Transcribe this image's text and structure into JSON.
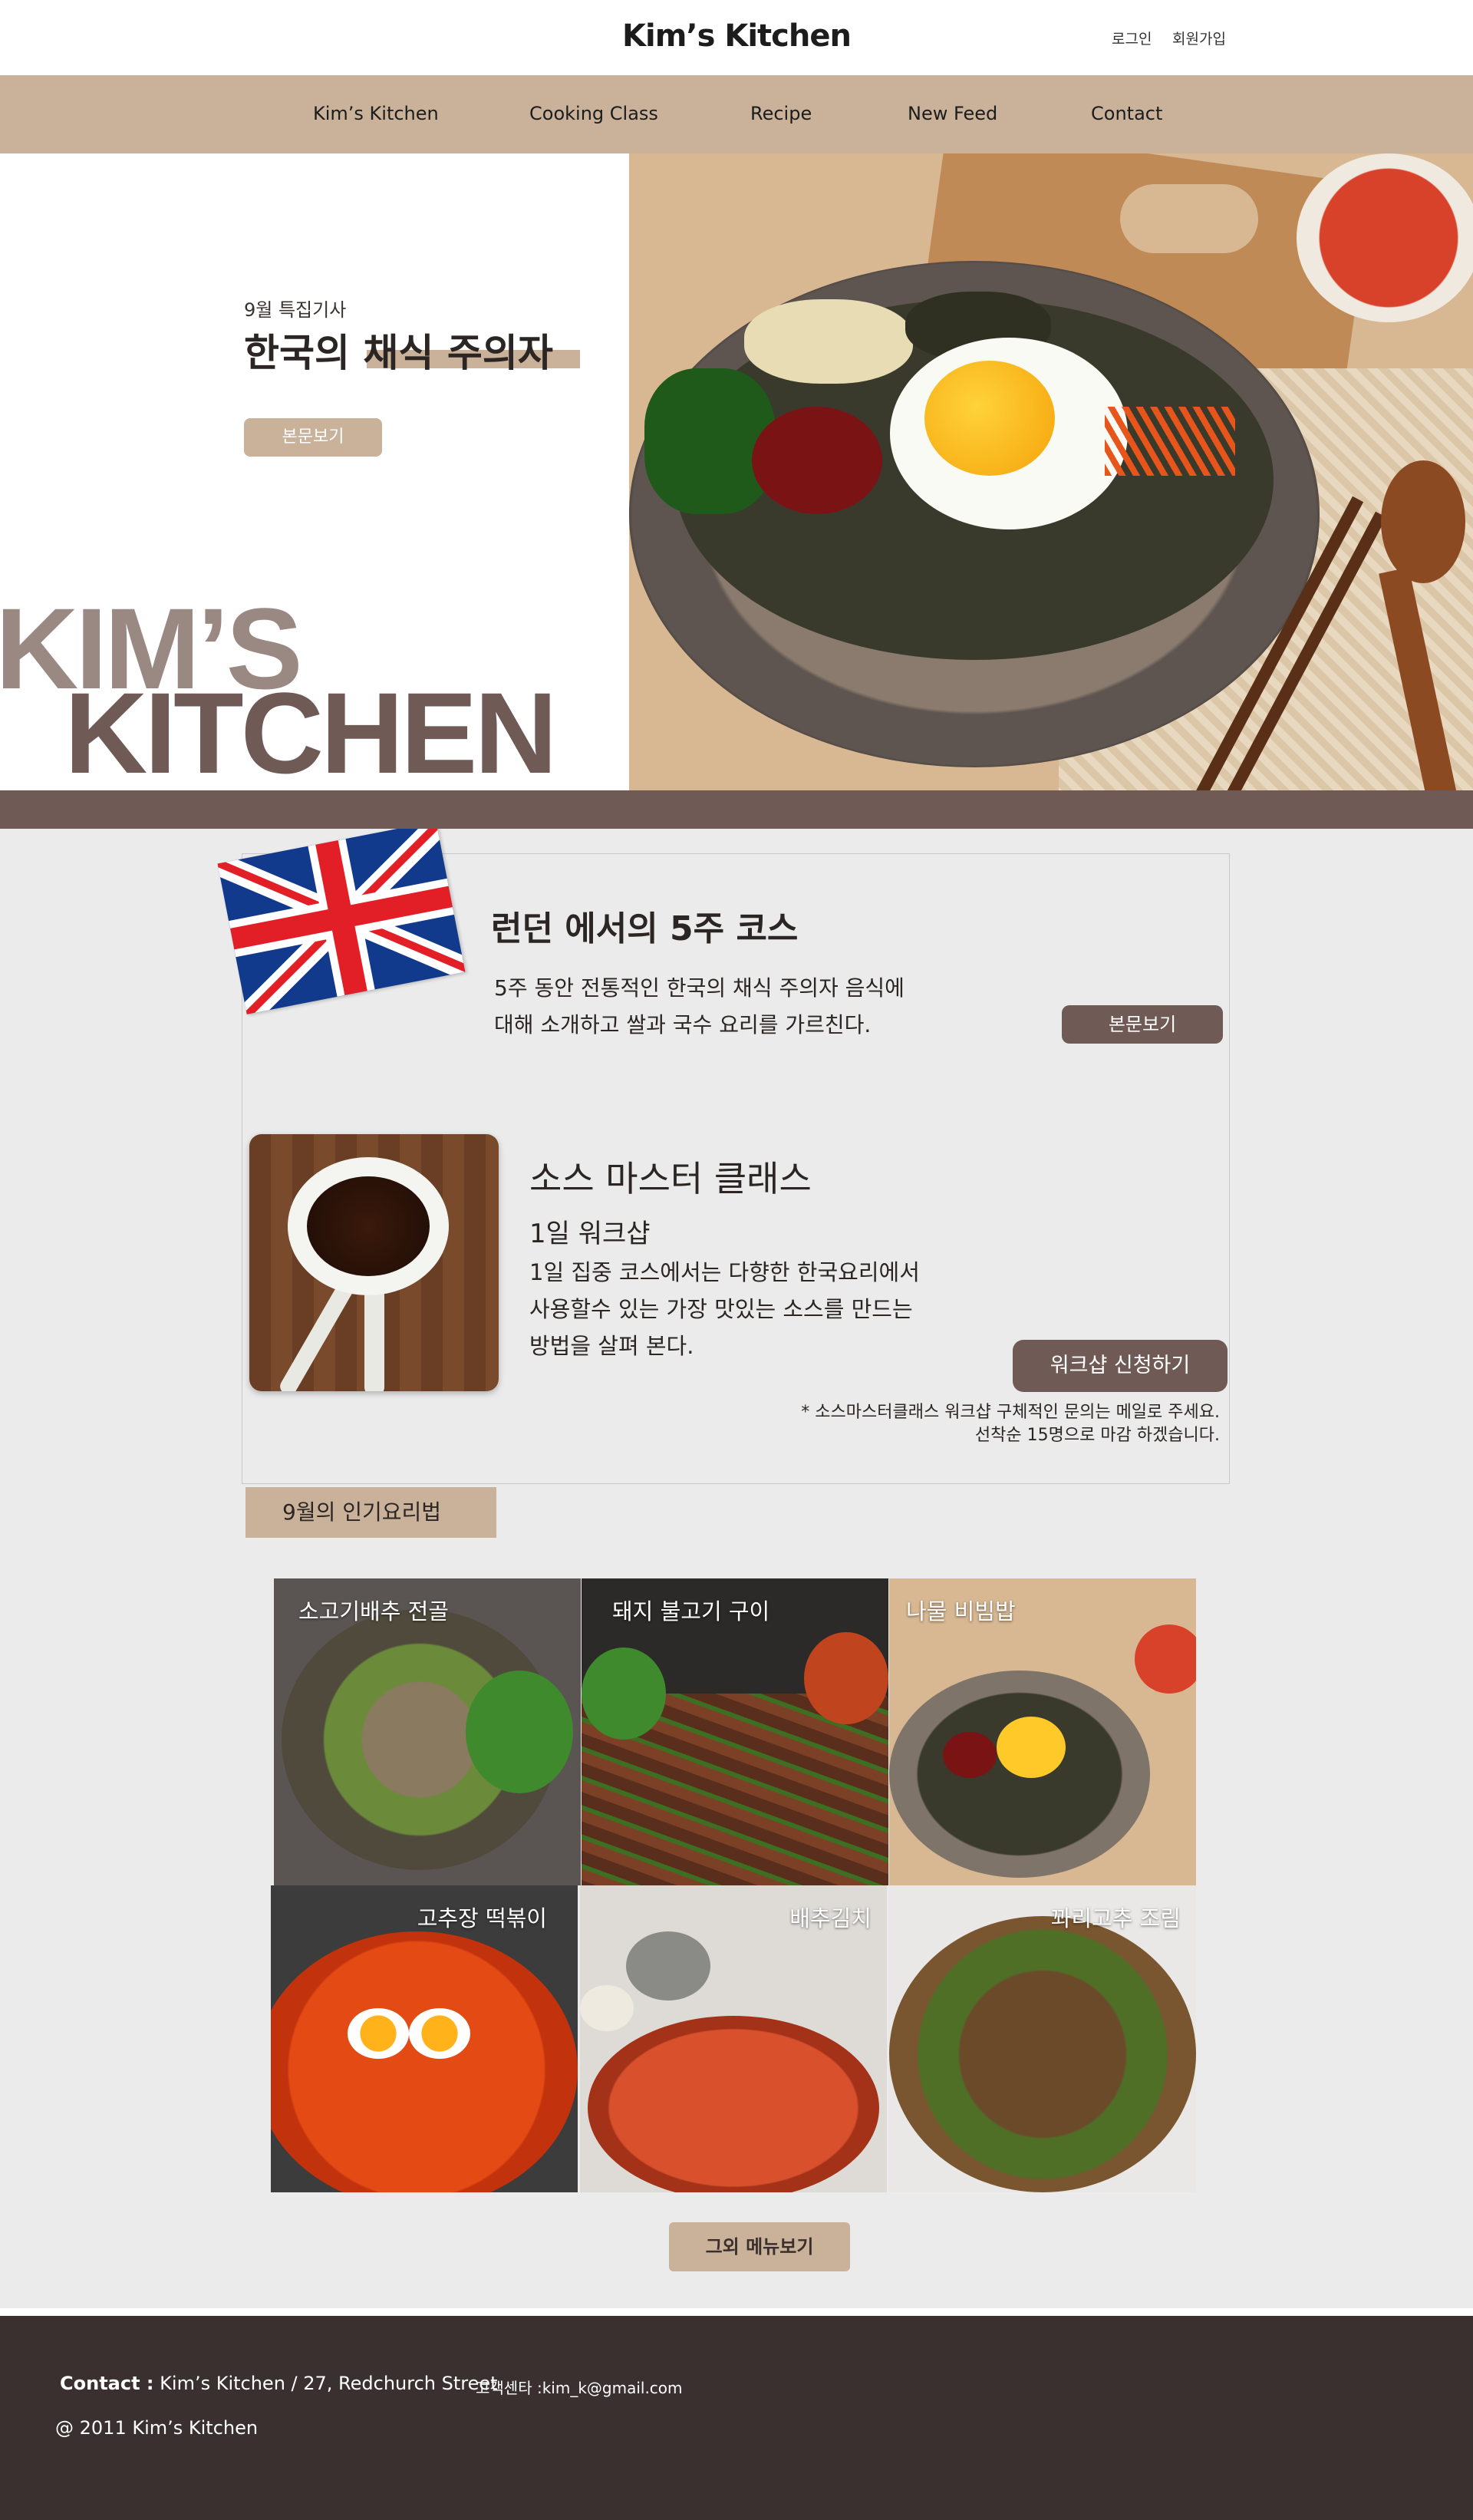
{
  "header": {
    "brand": "Kim’s Kitchen",
    "login": "로그인",
    "signup": "회원가입"
  },
  "nav": {
    "items": [
      {
        "label": "Kim’s Kitchen"
      },
      {
        "label": "Cooking Class"
      },
      {
        "label": "Recipe"
      },
      {
        "label": "New Feed"
      },
      {
        "label": "Contact"
      }
    ]
  },
  "hero": {
    "kicker": "9월 특집기사",
    "title": "한국의 채식 주의자",
    "button": "본문보기",
    "big_line1": "KIM’S",
    "big_line2": "KITCHEN"
  },
  "courses": {
    "london": {
      "title": "런던 에서의 5주 코스",
      "desc_line1": "5주 동안 전통적인 한국의 채식 주의자 음식에",
      "desc_line2": "대해 소개하고 쌀과 국수 요리를 가르친다.",
      "button": "본문보기"
    },
    "sauce": {
      "title": "소스 마스터 클래스",
      "subtitle": "1일 워크샵",
      "desc_line1": "1일 집중 코스에서는 다향한 한국요리에서",
      "desc_line2": "사용할수 있는 가장 맛있는 소스를 만드는",
      "desc_line3": "방법을 살펴 본다.",
      "button": "워크샵 신청하기",
      "note_line1": "* 소스마스터클래스 워크샵 구체적인 문의는 메일로 주세요.",
      "note_line2": "선착순 15명으로 마감 하겠습니다."
    }
  },
  "popular": {
    "section_title": "9월의 인기요리법",
    "recipes": [
      {
        "label": "소고기배추 전골"
      },
      {
        "label": "돼지 불고기 구이"
      },
      {
        "label": "나물 비빔밥"
      },
      {
        "label": "고추장 떡볶이"
      },
      {
        "label": "배추김치"
      },
      {
        "label": "꽈리고추 조림"
      }
    ],
    "more_button": "그외 메뉴보기"
  },
  "footer": {
    "contact_label": "Contact :",
    "contact_value": "Kim’s Kitchen  /  27, Redchurch Street",
    "service": "고객센타 :kim_k@gmail.com",
    "copyright": "@ 2011 Kim’s Kitchen"
  },
  "colors": {
    "beige": "#c9b299",
    "brown": "#6f5a55",
    "footer": "#3a302f",
    "gray_bg": "#ebebeb"
  }
}
